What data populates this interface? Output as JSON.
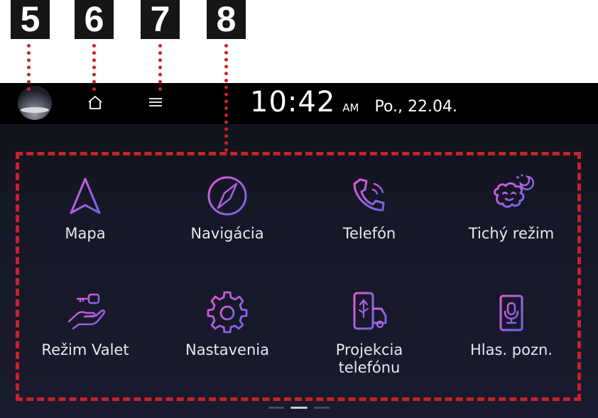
{
  "callouts": [
    "5",
    "6",
    "7",
    "8"
  ],
  "statusbar": {
    "time": "10:42",
    "ampm": "AM",
    "date": "Po., 22.04."
  },
  "icons": {
    "avatar": "profile-avatar",
    "home": "home-icon",
    "menu": "hamburger-menu-icon"
  },
  "apps": [
    {
      "label": "Mapa",
      "icon": "map-arrow-icon"
    },
    {
      "label": "Navigácia",
      "icon": "compass-icon"
    },
    {
      "label": "Telefón",
      "icon": "phone-icon"
    },
    {
      "label": "Tichý režim",
      "icon": "quiet-mode-icon"
    },
    {
      "label": "Režim Valet",
      "icon": "valet-key-icon"
    },
    {
      "label": "Nastavenia",
      "icon": "settings-gear-icon"
    },
    {
      "label": "Projekcia\ntelefónu",
      "icon": "phone-projection-icon"
    },
    {
      "label": "Hlas. pozn.",
      "icon": "voice-memo-icon"
    }
  ],
  "pager": {
    "pages": 3,
    "active": 2
  },
  "colors": {
    "callout_bg": "#161616",
    "dotted_lines": "#c8222a",
    "icon_gradient_start": "#e25bd6",
    "icon_gradient_end": "#6f63e8"
  }
}
